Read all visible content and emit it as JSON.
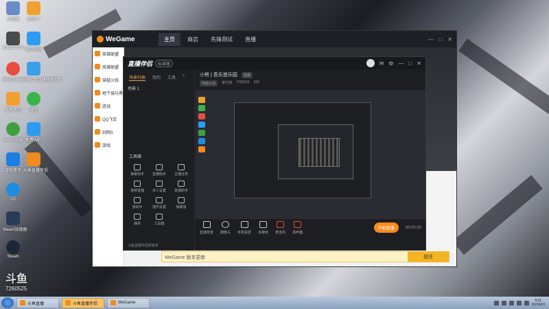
{
  "desktop": {
    "icons": [
      {
        "label": "计算机",
        "color": "#6a8cc4"
      },
      {
        "label": "多玩YY",
        "color": "#f0a030"
      },
      {
        "label": "2d6217970...",
        "color": "#4a4a4a"
      },
      {
        "label": "腾讯视频",
        "color": "#2d9cf0"
      },
      {
        "label": "网络浏览器",
        "color": "#e84e40"
      },
      {
        "label": "网易UU加速器网页版",
        "color": "#3aa0e8"
      },
      {
        "label": "植物大战",
        "color": "#f0a030"
      },
      {
        "label": "微信",
        "color": "#39b54a"
      },
      {
        "label": "360浏览器",
        "color": "#40a040"
      },
      {
        "label": "免费WiFi",
        "color": "#2d9cf0"
      },
      {
        "label": "游戏盒子",
        "color": "#1c7ee0"
      },
      {
        "label": "斗鱼直播伴侣",
        "color": "#f08a1c"
      },
      {
        "label": "QQ",
        "color": "#1c8ee0"
      },
      {
        "label": "Steam加速器",
        "color": "#2a3a5a"
      },
      {
        "label": "Steam",
        "color": "#1b2838"
      }
    ]
  },
  "watermark": {
    "logo": "斗鱼",
    "room": "7260525"
  },
  "wegame": {
    "title": "WeGame",
    "nav": [
      "主页",
      "商店",
      "先锋测试",
      "直播"
    ],
    "sidebar": [
      "英雄联盟",
      "英雄联盟",
      "穿越火线",
      "地下城与勇士",
      "逆战",
      "QQ飞车",
      "剑网3",
      "游戏"
    ],
    "bottom_text": "WeGame 版本更新",
    "bottom_action": "前往"
  },
  "zb": {
    "title": "直播伴侣",
    "badge": "标准版",
    "left_tabs": [
      "场景列表",
      "我的",
      "工具"
    ],
    "scene": "场景 1",
    "tools_title": "工具箱",
    "tools": [
      "弹幕助手",
      "直播助手",
      "主播任务",
      "视频直播",
      "本人设置",
      "直播助手",
      "游戏中",
      "插件设置",
      "弹幕墙",
      "抽奖",
      "工具箱"
    ],
    "promo": "斗鱼直播伴侣新版本",
    "room_title": "小熊 | 吾乐悠乐园",
    "room_tag": "直播",
    "sub_info": [
      "穿越火线",
      "排行榜",
      "7260525",
      "220"
    ],
    "controls": [
      "直播背景",
      "摄像头",
      "手机投屏",
      "多媒体",
      "麦克风",
      "扬声器"
    ],
    "timer": "00:00:00",
    "golive": "开始直播"
  },
  "taskbar": {
    "items": [
      "斗鱼直播",
      "斗鱼直播伴侣",
      "WeGame"
    ],
    "time": "9:31",
    "date": "2023/4/3"
  }
}
